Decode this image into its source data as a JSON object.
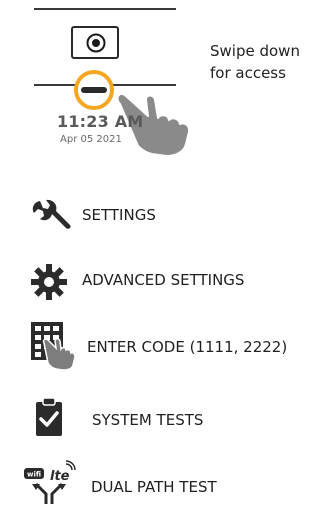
{
  "header": {
    "swipe_line1": "Swipe down",
    "swipe_line2": "for access",
    "time": "11:23 AM",
    "date": "Apr 05 2021"
  },
  "menu": {
    "settings": "SETTINGS",
    "advanced_settings": "ADVANCED SETTINGS",
    "enter_code": "ENTER CODE (1111, 2222)",
    "system_tests": "SYSTEM TESTS",
    "dual_path_test": "DUAL PATH TEST"
  },
  "colors": {
    "highlight_ring": "#f5a623",
    "icon_dark": "#2b2b2b",
    "hand_gray": "#8a8a8a"
  },
  "icons": [
    "camera-icon",
    "hand-pointer-icon",
    "wrench-icon",
    "gear-icon",
    "keypad-hand-icon",
    "clipboard-check-icon",
    "wifi-lte-icon"
  ]
}
